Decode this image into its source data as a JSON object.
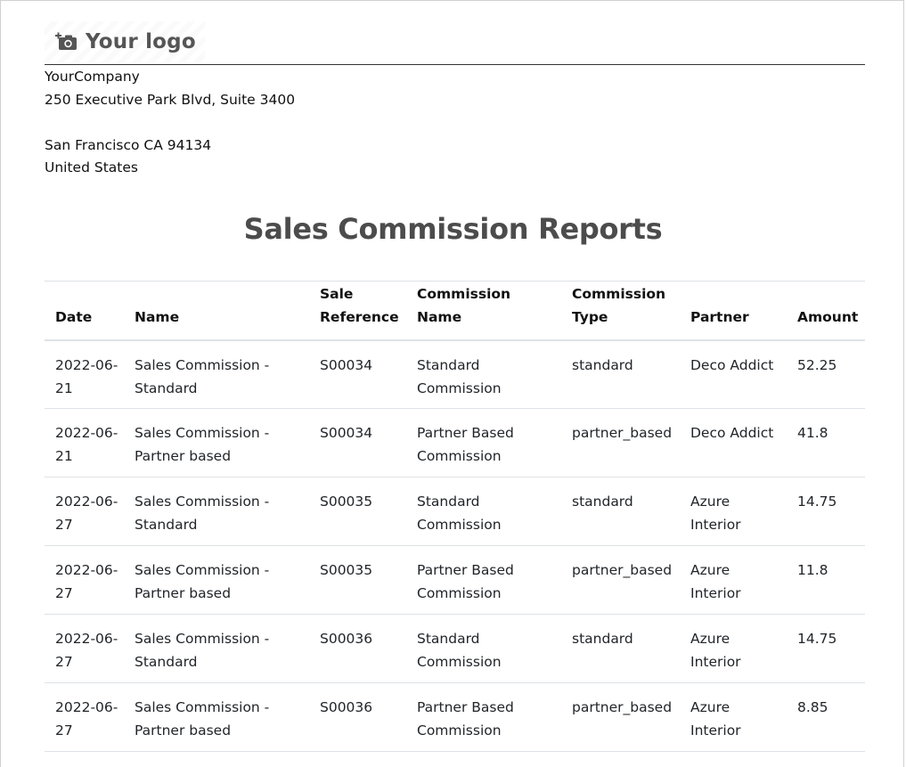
{
  "logo": {
    "text": "Your logo",
    "icon": "camera-plus-icon"
  },
  "company": {
    "name": "YourCompany",
    "address_line1": "250 Executive Park Blvd, Suite 3400",
    "address_line2": "",
    "city_line": "San Francisco CA 94134",
    "country": "United States"
  },
  "report": {
    "title": "Sales Commission Reports",
    "columns": {
      "date": "Date",
      "name": "Name",
      "sale_reference": "Sale Reference",
      "commission_name": "Commission Name",
      "commission_type": "Commission Type",
      "partner": "Partner",
      "amount": "Amount"
    },
    "rows": [
      {
        "date": "2022-06-21",
        "name": "Sales Commission - Standard",
        "sale_reference": "S00034",
        "commission_name": "Standard Commission",
        "commission_type": "standard",
        "partner": "Deco Addict",
        "amount": "52.25"
      },
      {
        "date": "2022-06-21",
        "name": "Sales Commission - Partner based",
        "sale_reference": "S00034",
        "commission_name": "Partner Based Commission",
        "commission_type": "partner_based",
        "partner": "Deco Addict",
        "amount": "41.8"
      },
      {
        "date": "2022-06-27",
        "name": "Sales Commission - Standard",
        "sale_reference": "S00035",
        "commission_name": "Standard Commission",
        "commission_type": "standard",
        "partner": "Azure Interior",
        "amount": "14.75"
      },
      {
        "date": "2022-06-27",
        "name": "Sales Commission - Partner based",
        "sale_reference": "S00035",
        "commission_name": "Partner Based Commission",
        "commission_type": "partner_based",
        "partner": "Azure Interior",
        "amount": "11.8"
      },
      {
        "date": "2022-06-27",
        "name": "Sales Commission - Standard",
        "sale_reference": "S00036",
        "commission_name": "Standard Commission",
        "commission_type": "standard",
        "partner": "Azure Interior",
        "amount": "14.75"
      },
      {
        "date": "2022-06-27",
        "name": "Sales Commission - Partner based",
        "sale_reference": "S00036",
        "commission_name": "Partner Based Commission",
        "commission_type": "partner_based",
        "partner": "Azure Interior",
        "amount": "8.85"
      }
    ]
  }
}
